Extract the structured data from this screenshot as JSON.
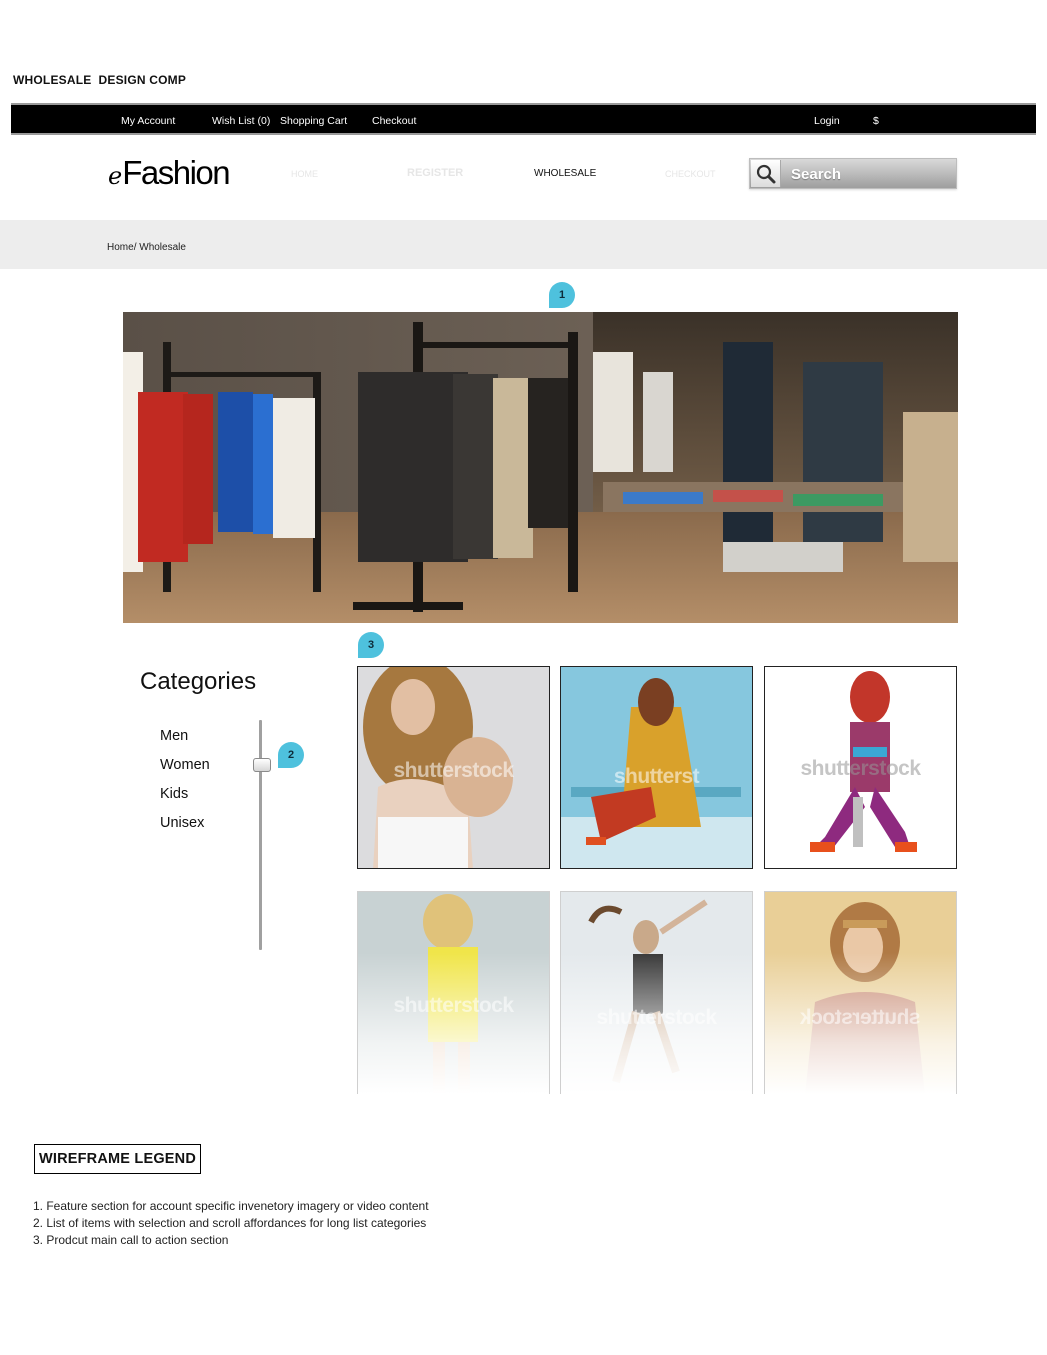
{
  "comp_title": "WHOLESALE  DESIGN COMP",
  "topbar": {
    "my_account": "My Account",
    "wish_list": "Wish List (0)",
    "shopping_cart": "Shopping Cart",
    "checkout": "Checkout",
    "login": "Login",
    "currency": "$"
  },
  "logo": {
    "prefix": "e",
    "name": "Fashion"
  },
  "main_nav": {
    "home": "HOME",
    "register": "REGISTER",
    "wholesale": "WHOLESALE",
    "checkout": "CHECKOUT",
    "active": "wholesale"
  },
  "search": {
    "placeholder": "Search",
    "icon": "search-icon"
  },
  "breadcrumb": {
    "home": "Home",
    "separator": "/ ",
    "current": "Wholesale"
  },
  "markers": {
    "feature": "1",
    "list": "2",
    "products": "3",
    "color": "#4ec1dd"
  },
  "categories": {
    "title": "Categories",
    "items": [
      {
        "label": "Men"
      },
      {
        "label": "Women"
      },
      {
        "label": "Kids"
      },
      {
        "label": "Unisex"
      }
    ]
  },
  "products": {
    "watermarks": [
      "shutterstock",
      "shutterst",
      "shutterstock",
      "shutterstock",
      "shutterstock",
      "shutterstock"
    ]
  },
  "legend": {
    "title": "WIREFRAME LEGEND",
    "items": [
      "1. Feature section for account specific invenetory imagery or video content",
      "2. List of items with selection and scroll affordances for long list categories",
      "3. Prodcut main call to action section"
    ]
  }
}
